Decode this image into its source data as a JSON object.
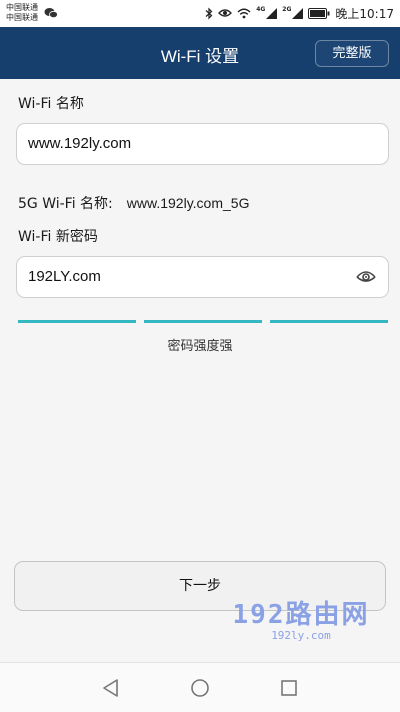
{
  "status_bar": {
    "carrier_1": "中国联通",
    "carrier_2": "中国联通",
    "network_1": "4G",
    "network_2": "2G",
    "time": "晚上10:17"
  },
  "header": {
    "title": "Wi-Fi 设置",
    "full_version_label": "完整版"
  },
  "form": {
    "wifi_name_label": "Wi-Fi 名称",
    "wifi_name_value": "www.192ly.com",
    "wifi_5g_label": "5G Wi-Fi 名称:",
    "wifi_5g_value": "www.192ly.com_5G",
    "password_label": "Wi-Fi 新密码",
    "password_value": "192LY.com",
    "strength_text": "密码强度强",
    "strength_color": "#34b7c0"
  },
  "actions": {
    "next_label": "下一步"
  },
  "watermark": {
    "big_text": "192路由网",
    "small_text": "192ly.com"
  },
  "colors": {
    "header_bg": "#163f6d",
    "page_bg": "#f5f5f5"
  }
}
